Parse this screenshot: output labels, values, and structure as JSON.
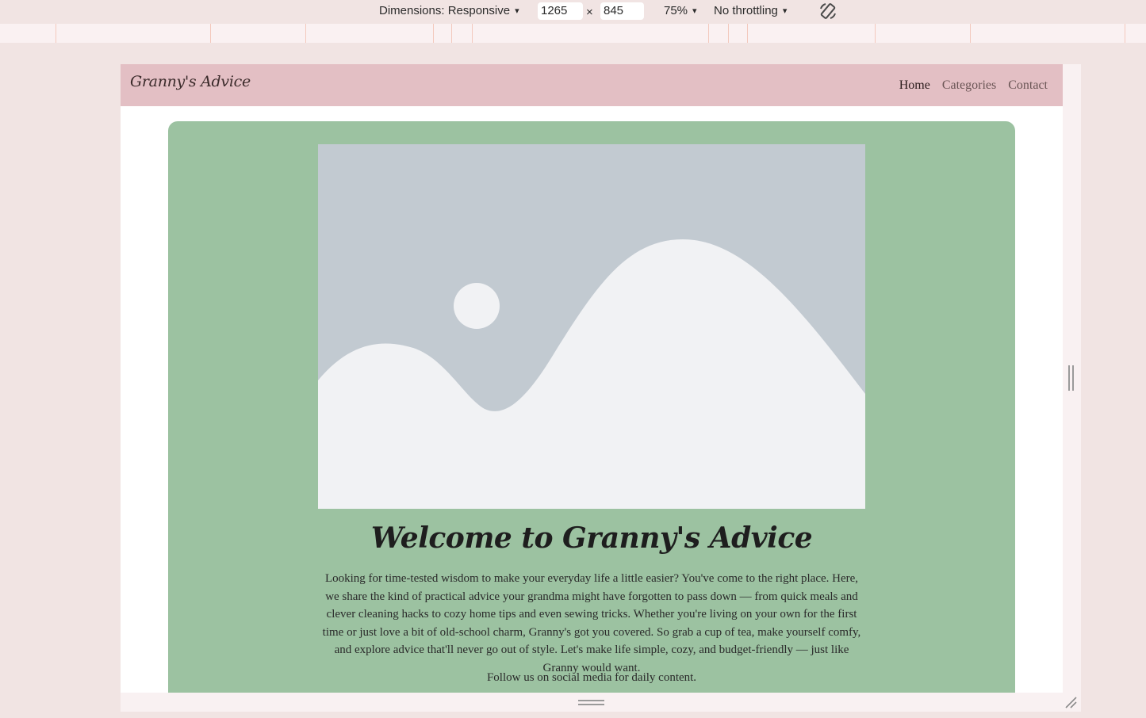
{
  "devtools": {
    "dimensions_label": "Dimensions: Responsive",
    "width_value": "1265",
    "times_symbol": "×",
    "height_value": "845",
    "zoom": "75%",
    "throttling": "No throttling",
    "caret": "▾",
    "rotate_icon": "rotate-icon"
  },
  "site": {
    "brand": "Granny's Advice",
    "nav": [
      {
        "label": "Home",
        "active": true
      },
      {
        "label": "Categories",
        "active": false
      },
      {
        "label": "Contact",
        "active": false
      }
    ],
    "hero": {
      "image_icon": "image-placeholder-icon",
      "title": "Welcome to Granny's Advice",
      "paragraph": "Looking for time-tested wisdom to make your everyday life a little easier? You've come to the right place. Here, we share the kind of practical advice your grandma might have forgotten to pass down — from quick meals and clever cleaning hacks to cozy home tips and even sewing tricks. Whether you're living on your own for the first time or just love a bit of old-school charm, Granny's got you covered. So grab a cup of tea, make yourself comfy, and explore advice that'll never go out of style. Let's make life simple, cozy, and budget-friendly — just like Granny would want.",
      "follow": "Follow us on social media for daily content."
    }
  },
  "colors": {
    "header_bg": "#e3bfc4",
    "hero_bg": "#9cc2a1",
    "page_bg": "#f1e4e3",
    "placeholder_sky": "#c2cad1",
    "placeholder_land": "#f1f2f4"
  }
}
